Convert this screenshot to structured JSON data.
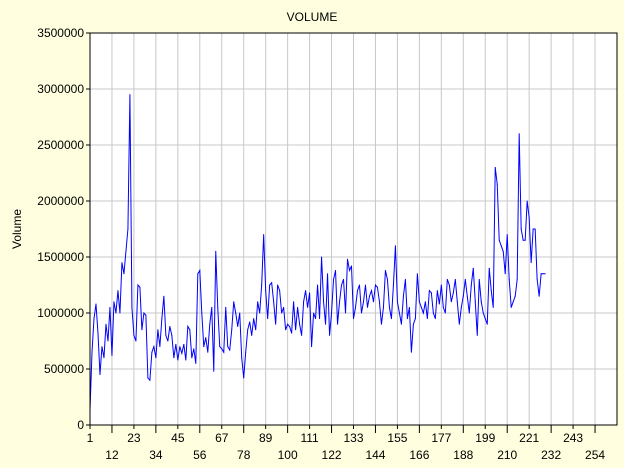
{
  "chart_data": {
    "type": "line",
    "title": "VOLUME",
    "xlabel": "",
    "ylabel": "Volume",
    "xlim": [
      1,
      265
    ],
    "ylim": [
      0,
      3500000
    ],
    "grid": true,
    "legend": "none",
    "x_ticks_row1": [
      "1",
      "23",
      "45",
      "67",
      "89",
      "111",
      "133",
      "155",
      "177",
      "199",
      "221",
      "243"
    ],
    "x_ticks_row2": [
      "12",
      "34",
      "56",
      "78",
      "100",
      "122",
      "144",
      "166",
      "188",
      "210",
      "232",
      "254"
    ],
    "y_ticks": [
      "0",
      "500000",
      "1000000",
      "1500000",
      "2000000",
      "2500000",
      "3000000",
      "3500000"
    ],
    "colors": {
      "line": "#0000ff",
      "background": "#ffffe0",
      "plot_background": "#ffffff",
      "grid": "#c8c8c8"
    },
    "series": [
      {
        "values": [
          130000,
          650000,
          950000,
          1080000,
          820000,
          450000,
          700000,
          600000,
          900000,
          750000,
          1050000,
          620000,
          1100000,
          1000000,
          1200000,
          1000000,
          1450000,
          1350000,
          1550000,
          1750000,
          2950000,
          1050000,
          800000,
          750000,
          1250000,
          1230000,
          850000,
          1000000,
          980000,
          420000,
          400000,
          650000,
          700000,
          600000,
          850000,
          700000,
          950000,
          1150000,
          800000,
          750000,
          880000,
          800000,
          600000,
          720000,
          580000,
          700000,
          640000,
          720000,
          580000,
          880000,
          850000,
          600000,
          680000,
          550000,
          1350000,
          1380000,
          1000000,
          700000,
          780000,
          650000,
          900000,
          1050000,
          480000,
          1550000,
          1050000,
          700000,
          680000,
          650000,
          1050000,
          700000,
          670000,
          850000,
          1100000,
          1000000,
          880000,
          1000000,
          600000,
          420000,
          650000,
          850000,
          920000,
          800000,
          950000,
          850000,
          1100000,
          1000000,
          1250000,
          1700000,
          1200000,
          950000,
          1250000,
          1270000,
          1100000,
          900000,
          1250000,
          1200000,
          1000000,
          1050000,
          850000,
          900000,
          880000,
          820000,
          1100000,
          850000,
          1050000,
          900000,
          800000,
          1100000,
          1200000,
          1050000,
          1180000,
          700000,
          1000000,
          950000,
          1250000,
          950000,
          1500000,
          1100000,
          900000,
          1350000,
          800000,
          1000000,
          1300000,
          1380000,
          900000,
          1100000,
          1250000,
          1300000,
          1000000,
          1480000,
          1380000,
          1420000,
          950000,
          1050000,
          1200000,
          1250000,
          1000000,
          1100000,
          1250000,
          1050000,
          1150000,
          1200000,
          1100000,
          1250000,
          1230000,
          1100000,
          900000,
          1050000,
          1380000,
          1300000,
          1050000,
          950000,
          1250000,
          1600000,
          1100000,
          1000000,
          900000,
          1150000,
          1300000,
          950000,
          1050000,
          650000,
          900000,
          950000,
          1350000,
          1100000,
          1050000,
          1000000,
          1100000,
          950000,
          1200000,
          1180000,
          1000000,
          950000,
          1200000,
          1080000,
          1250000,
          1050000,
          1000000,
          1300000,
          1250000,
          1100000,
          1180000,
          1300000,
          1100000,
          900000,
          1050000,
          1150000,
          1300000,
          1150000,
          1000000,
          1250000,
          1400000,
          1100000,
          800000,
          1300000,
          1100000,
          1000000,
          950000,
          900000,
          1400000,
          1200000,
          1050000,
          2300000,
          2150000,
          1650000,
          1600000,
          1550000,
          1350000,
          1700000,
          1300000,
          1050000,
          1100000,
          1150000,
          1300000,
          2600000,
          1750000,
          1650000,
          1650000,
          2000000,
          1850000,
          1450000,
          1750000,
          1750000,
          1300000,
          1150000,
          1350000,
          1350000,
          1350000
        ]
      }
    ]
  }
}
